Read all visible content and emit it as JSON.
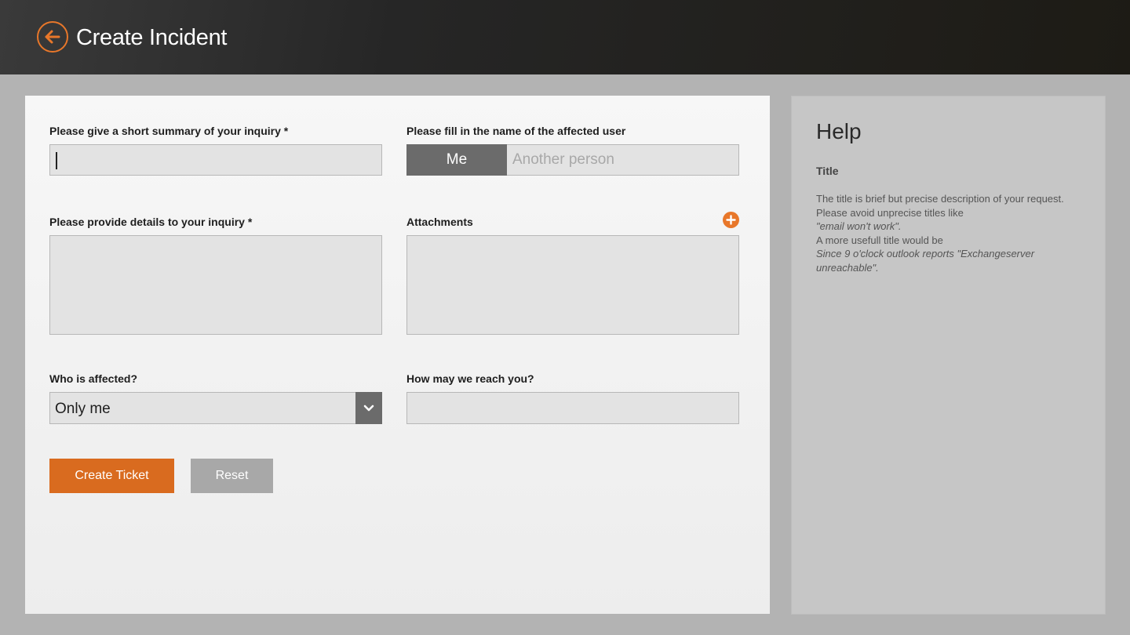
{
  "header": {
    "title": "Create Incident",
    "back_icon": "arrow-left-circle-icon",
    "accent_color": "#e8772a"
  },
  "form": {
    "summary": {
      "label": "Please give a short summary of your inquiry *",
      "value": ""
    },
    "affected_user": {
      "label": "Please fill in the name of the affected user",
      "option_me": "Me",
      "option_other_placeholder": "Another person",
      "selected": "Me"
    },
    "details": {
      "label": "Please provide details to your inquiry *",
      "value": ""
    },
    "attachments": {
      "label": "Attachments",
      "add_icon": "plus-circle-icon"
    },
    "who_affected": {
      "label": "Who is affected?",
      "selected": "Only me",
      "icon": "chevron-down-icon"
    },
    "reach": {
      "label": "How may we reach you?",
      "value": ""
    },
    "buttons": {
      "create": "Create Ticket",
      "reset": "Reset"
    }
  },
  "help": {
    "heading": "Help",
    "subheading": "Title",
    "lines": [
      {
        "text": "The title is brief but precise description of your request.",
        "italic": false
      },
      {
        "text": "Please avoid unprecise titles like",
        "italic": false
      },
      {
        "text": "\"email won't work\".",
        "italic": true
      },
      {
        "text": "A more usefull title would be",
        "italic": false
      },
      {
        "text": "Since 9 o'clock outlook reports \"Exchangeserver unreachable\".",
        "italic": true
      }
    ]
  },
  "colors": {
    "primary_button": "#d96b1f",
    "secondary_button": "#a8a8a8",
    "segment_selected": "#6b6b6b"
  }
}
